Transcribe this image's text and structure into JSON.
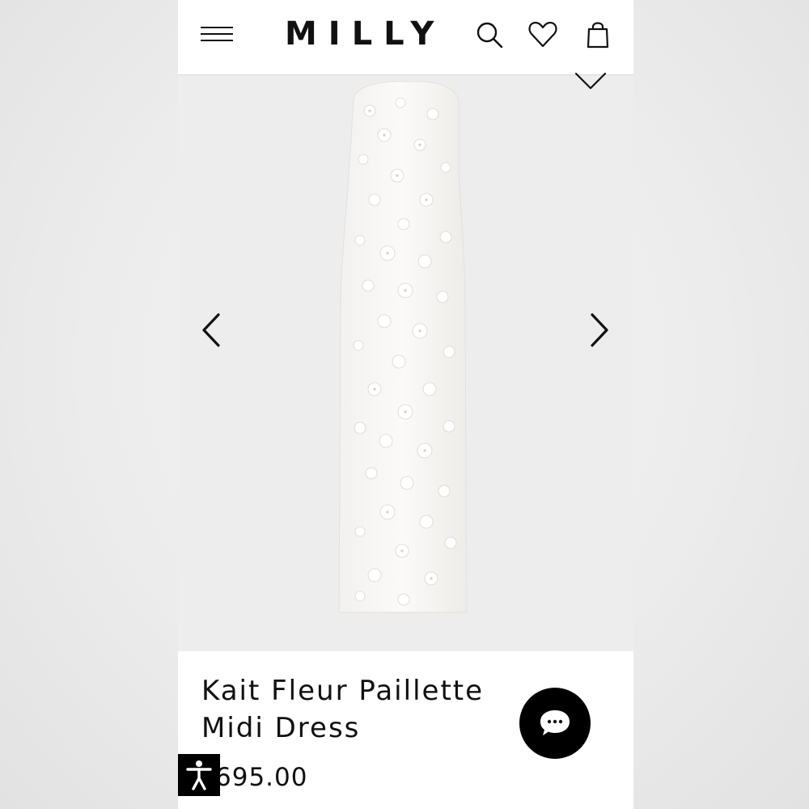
{
  "header": {
    "brand": "MILLY",
    "icons": {
      "menu": "hamburger-menu-icon",
      "search": "search-icon",
      "wishlist": "heart-icon",
      "bag": "shopping-bag-icon"
    }
  },
  "gallery": {
    "icons": {
      "favorite": "heart-outline-icon",
      "previous": "chevron-left-icon",
      "next": "chevron-right-icon"
    },
    "background": "#eeedee"
  },
  "product": {
    "title": "Kait Fleur Paillette Midi Dress",
    "price": "695.00"
  },
  "widgets": {
    "chat_icon": "chat-bubble-icon",
    "accessibility_icon": "accessibility-icon"
  },
  "colors": {
    "text": "#111111",
    "accent": "#000000"
  }
}
